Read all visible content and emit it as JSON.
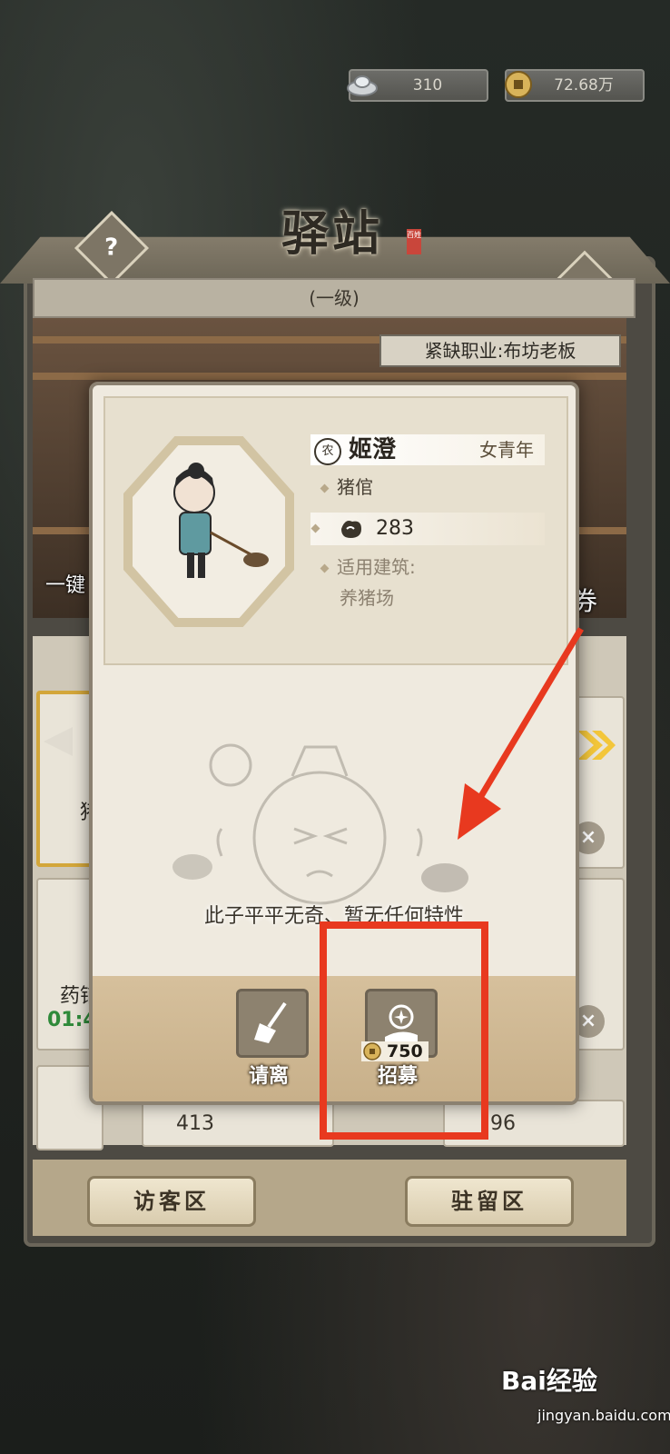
{
  "currency": {
    "silver": "310",
    "coins": "72.68万"
  },
  "building": {
    "title": "驿站",
    "seal": "百姓",
    "level": "(一级)",
    "scarce_job": "紧缺职业:布坊老板",
    "left_side_label": "一键",
    "right_side_label": "券"
  },
  "background_list": {
    "timer": "01:4",
    "job_left_top": "猪",
    "job_left_mid": "药铺",
    "stat_bottom_left": "413",
    "stat_bottom_right": "96"
  },
  "zones": {
    "visitor": "访客区",
    "resident": "驻留区"
  },
  "modal": {
    "badge": "农",
    "name": "姬澄",
    "gender_age": "女青年",
    "job": "猪倌",
    "stat_value": "283",
    "building_label": "适用建筑:",
    "building_value": "养猪场",
    "no_trait": "此子平平无奇、暂无任何特性",
    "dismiss_label": "请离",
    "recruit_label": "招募",
    "recruit_cost": "750"
  },
  "annotation": {
    "color": "#e8391f"
  },
  "watermark": {
    "main": "Bai经验",
    "sub": "jingyan.baidu.com"
  }
}
